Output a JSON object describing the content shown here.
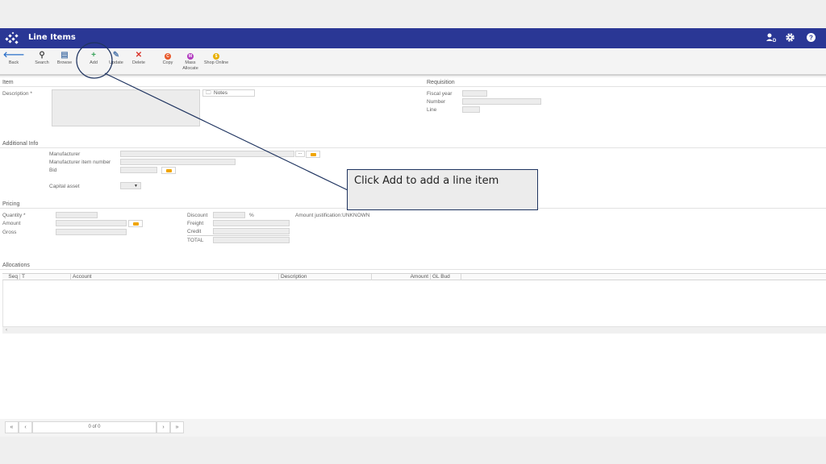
{
  "header": {
    "title": "Line Items",
    "icons": [
      "user-switch-icon",
      "gear-icon",
      "help-icon"
    ]
  },
  "toolbar": {
    "back": "Back",
    "search": "Search",
    "browse": "Browse",
    "add": "Add",
    "update": "Update",
    "delete": "Delete",
    "copy": "Copy",
    "mass_allocate_1": "Mass",
    "mass_allocate_2": "Allocate",
    "shop_online": "Shop Online"
  },
  "item": {
    "section": "Item",
    "description_label": "Description *",
    "notes_button": "Notes"
  },
  "requisition": {
    "section": "Requisition",
    "fiscal_year": "Fiscal year",
    "number": "Number",
    "line": "Line"
  },
  "additional": {
    "section": "Additional Info",
    "manufacturer": "Manufacturer",
    "manufacturer_item_number": "Manufacturer item number",
    "bid": "Bid",
    "capital_asset": "Capital asset",
    "lookup_dots": "..."
  },
  "pricing": {
    "section": "Pricing",
    "quantity": "Quantity *",
    "amount": "Amount",
    "gross": "Gross",
    "discount": "Discount",
    "percent": "%",
    "freight": "Freight",
    "credit": "Credit",
    "total": "TOTAL",
    "amount_justification": "Amount justification:UNKNOWN"
  },
  "allocations": {
    "section": "Allocations",
    "columns": [
      "Seq",
      "T",
      "Account",
      "Description",
      "Amount",
      "GL Bud"
    ],
    "scroll_left": "‹"
  },
  "pager": {
    "first": "«",
    "prev": "‹",
    "status": "0 of 0",
    "next": "›",
    "last": "»"
  },
  "callout": {
    "text": "Click Add to add a line item"
  },
  "colors": {
    "header": "#2a3795",
    "add": "#3aa35c",
    "delete": "#d9342b",
    "copy": "#e8582a",
    "mass": "#b23bbf",
    "shop": "#e8b000"
  }
}
